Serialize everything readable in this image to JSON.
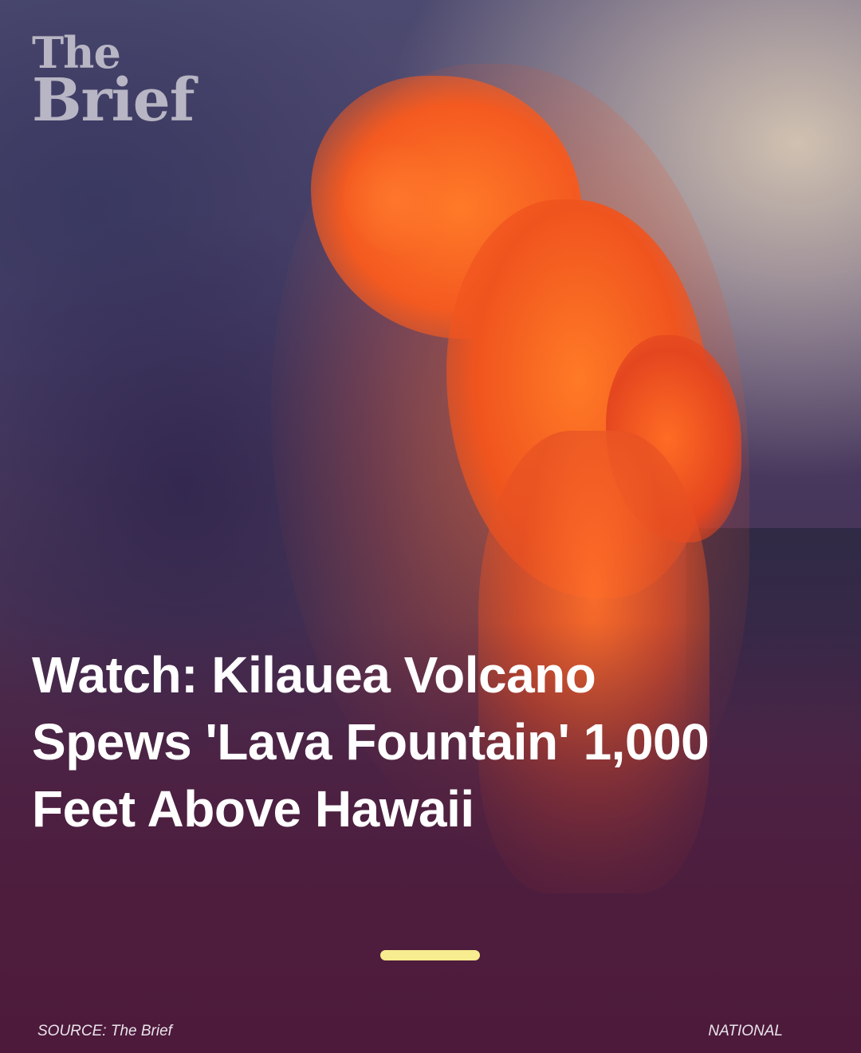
{
  "brand": {
    "logo_line1": "The",
    "logo_line2": "Brief"
  },
  "story": {
    "headline": "Watch: Kilauea Volcano Spews 'Lava Fountain' 1,000 Feet Above Hawaii",
    "slide_progress_color": "#f7ec8f"
  },
  "footer": {
    "source": "SOURCE: The Brief",
    "category": "NATIONAL"
  },
  "colors": {
    "lava": "#f45a20",
    "headline_text": "#ffffff",
    "logo_text": "#b8b5c4",
    "background_bottom": "#4d1a3b"
  }
}
